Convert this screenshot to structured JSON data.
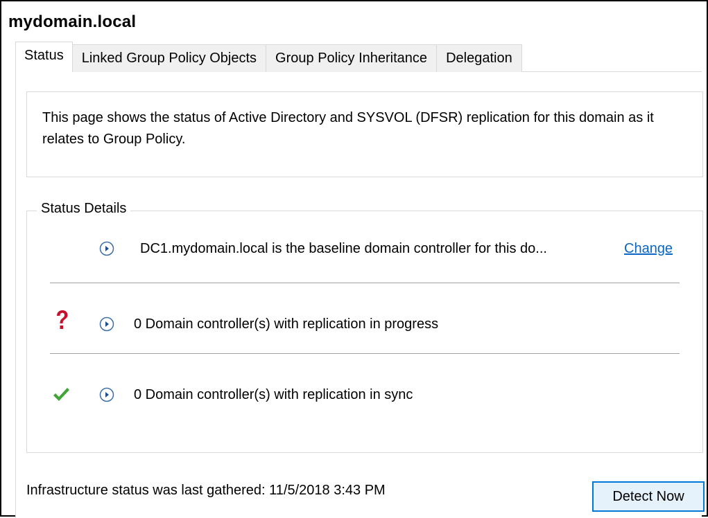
{
  "window": {
    "domain_title": "mydomain.local"
  },
  "tabs": [
    {
      "label": "Status",
      "active": true
    },
    {
      "label": "Linked Group Policy Objects",
      "active": false
    },
    {
      "label": "Group Policy Inheritance",
      "active": false
    },
    {
      "label": "Delegation",
      "active": false
    }
  ],
  "description": "This page shows the status of Active Directory and SYSVOL (DFSR) replication for this domain as it relates to Group Policy.",
  "status_details": {
    "legend": "Status Details",
    "baseline": {
      "text": "DC1.mydomain.local is the baseline domain controller for this do...",
      "link_label": "Change",
      "link_color": "#0b66c3"
    },
    "in_progress": {
      "icon": "question-mark-icon",
      "icon_color": "#c8102e",
      "text": "0 Domain controller(s) with replication in progress"
    },
    "in_sync": {
      "icon": "checkmark-icon",
      "icon_color": "#3fa535",
      "text": "0 Domain controller(s) with replication in sync"
    }
  },
  "footer": {
    "last_gathered_text": "Infrastructure status was last gathered: 11/5/2018 3:43 PM",
    "detect_button_label": "Detect Now"
  }
}
